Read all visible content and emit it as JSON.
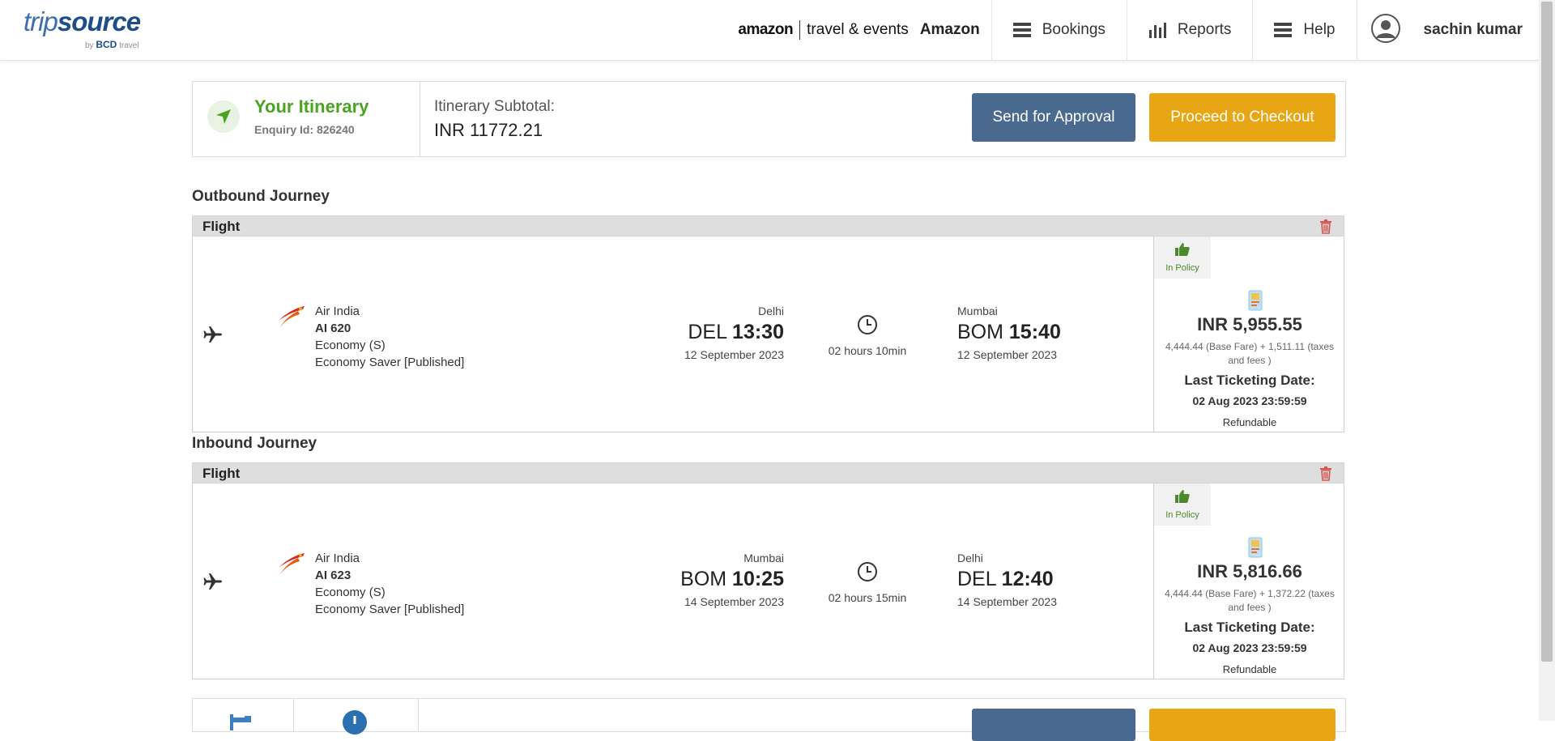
{
  "header": {
    "logo_main_a": "trip",
    "logo_main_b": "source",
    "logo_sub_by": "by",
    "logo_sub_bcd": "BCD",
    "logo_sub_travel": "travel",
    "company_logo_brand": "amazon",
    "company_logo_text": "travel & events",
    "company_name": "Amazon",
    "nav": {
      "bookings": "Bookings",
      "reports": "Reports",
      "help": "Help"
    },
    "user_name": "sachin kumar"
  },
  "summary": {
    "title": "Your Itinerary",
    "enquiry_label": "Enquiry Id: 826240",
    "subtotal_label": "Itinerary Subtotal:",
    "subtotal_value": "INR  11772.21",
    "send_approval": "Send for Approval",
    "checkout": "Proceed to Checkout"
  },
  "outbound": {
    "title": "Outbound Journey",
    "card_label": "Flight",
    "airline": "Air India",
    "flight_no": "AI 620",
    "cabin": "Economy (S)",
    "fare_type": "Economy Saver [Published]",
    "dep_city": "Delhi",
    "dep_code": "DEL",
    "dep_time": "13:30",
    "dep_date": "12 September 2023",
    "duration": "02 hours 10min",
    "arr_city": "Mumbai",
    "arr_code": "BOM",
    "arr_time": "15:40",
    "arr_date": "12 September 2023",
    "policy": "In Policy",
    "price": "INR 5,955.55",
    "breakdown": "4,444.44 (Base Fare) + 1,511.11 (taxes and fees )",
    "ltd_label": "Last Ticketing Date:",
    "ltd_value": "02 Aug 2023 23:59:59",
    "refund": "Refundable"
  },
  "inbound": {
    "title": "Inbound Journey",
    "card_label": "Flight",
    "airline": "Air India",
    "flight_no": "AI 623",
    "cabin": "Economy (S)",
    "fare_type": "Economy Saver [Published]",
    "dep_city": "Mumbai",
    "dep_code": "BOM",
    "dep_time": "10:25",
    "dep_date": "14 September 2023",
    "duration": "02 hours 15min",
    "arr_city": "Delhi",
    "arr_code": "DEL",
    "arr_time": "12:40",
    "arr_date": "14 September 2023",
    "policy": "In Policy",
    "price": "INR 5,816.66",
    "breakdown": "4,444.44 (Base Fare) + 1,372.22 (taxes and fees )",
    "ltd_label": "Last Ticketing Date:",
    "ltd_value": "02 Aug 2023 23:59:59",
    "refund": "Refundable"
  },
  "icons": {
    "bookings": "list-icon",
    "reports": "bar-chart-icon",
    "help": "list-icon",
    "user": "user-avatar-icon",
    "itinerary": "navigation-arrow-icon",
    "delete": "trash-icon",
    "flight": "plane-icon",
    "airline": "air-india-logo",
    "duration": "clock-icon",
    "policy": "thumbs-up-icon",
    "fare": "fare-card-icon"
  },
  "colors": {
    "brand_blue": "#3e6fb0",
    "itinerary_green": "#4aa421",
    "approval_button": "#4a6b8f",
    "checkout_button": "#e9a614",
    "delete_red": "#d9534f",
    "policy_green": "#4a8a2c"
  }
}
